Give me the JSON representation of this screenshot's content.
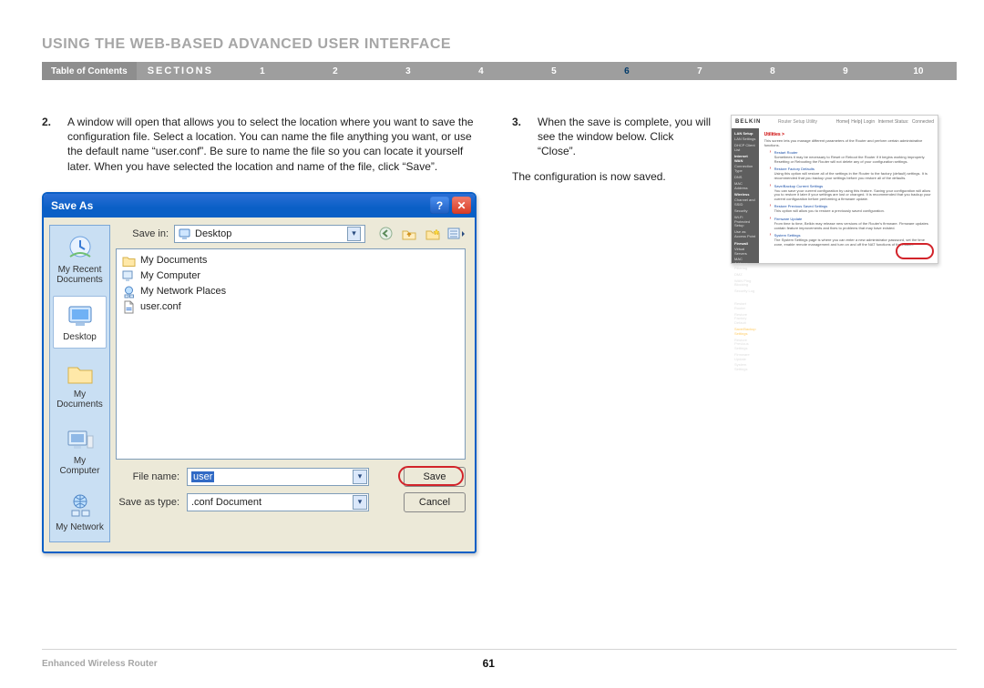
{
  "page": {
    "title": "USING THE WEB-BASED ADVANCED USER INTERFACE",
    "footer_product": "Enhanced Wireless Router",
    "page_number": "61"
  },
  "nav": {
    "toc": "Table of Contents",
    "sections": "SECTIONS",
    "items": [
      "1",
      "2",
      "3",
      "4",
      "5",
      "6",
      "7",
      "8",
      "9",
      "10"
    ],
    "active": "6"
  },
  "steps": {
    "s2": {
      "num": "2.",
      "text": "A window will open that allows you to select the location where you want to save the configuration file. Select a location. You can name the file anything you want, or use the default name “user.conf”. Be sure to name the file so you can locate it yourself later. When you have selected the location and name of the file, click “Save”."
    },
    "s3": {
      "num": "3.",
      "text": "When the save is complete, you will see the window below. Click “Close”."
    },
    "note": "The configuration is now saved."
  },
  "saveas": {
    "title": "Save As",
    "save_in_label": "Save in:",
    "save_in_value": "Desktop",
    "places": {
      "recent": "My Recent Documents",
      "desktop": "Desktop",
      "mydocs": "My Documents",
      "mycomputer": "My Computer",
      "mynetwork": "My Network"
    },
    "folder_items": [
      {
        "label": "My Documents"
      },
      {
        "label": "My Computer"
      },
      {
        "label": "My Network Places"
      },
      {
        "label": "user.conf"
      }
    ],
    "file_name_label": "File name:",
    "file_name_value": "user",
    "save_type_label": "Save as type:",
    "save_type_value": ".conf Document",
    "save_btn": "Save",
    "cancel_btn": "Cancel"
  },
  "belkin": {
    "brand": "BELKIN",
    "product": "Router Setup Utility",
    "links": {
      "home": "Home",
      "help": "Help",
      "login": "Login",
      "status": "Internet Status:",
      "logout": "Connected"
    },
    "sidebar": {
      "g1": "LAN Setup",
      "i1a": "LAN Settings",
      "i1b": "DHCP Client List",
      "g2": "Internet WAN",
      "i2a": "Connection Type",
      "i2b": "DNS",
      "i2c": "MAC Address",
      "g3": "Wireless",
      "i3a": "Channel and SSID",
      "i3b": "Security",
      "i3c": "Wi-Fi Protected Setup",
      "i3d": "Use as Access Point",
      "g4": "Firewall",
      "i4a": "Virtual Servers",
      "i4b": "MAC Address Filtering",
      "i4c": "DMZ",
      "i4d": "WAN Ping Blocking",
      "i4e": "Security Log",
      "g5": "Utilities",
      "i5a": "Restart Router",
      "i5b": "Restore Factory Default",
      "i5c": "Save/Backup Settings",
      "i5d": "Restore Previous Settings",
      "i5e": "Firmware Update",
      "i5f": "System Settings"
    },
    "main": {
      "heading": "Utilities >",
      "p1": "This screen lets you manage different parameters of the Router and perform certain administrative functions.",
      "b1t": "Restart Router",
      "b1": "Sometimes it may be necessary to Reset or Reboot the Router if it begins working improperly. Resetting or Rebooting the Router will not delete any of your configuration settings.",
      "b2t": "Restore Factory Defaults",
      "b2": "Using this option will restore all of the settings in the Router to the factory (default) settings. It is recommended that you backup your settings before you restore all of the defaults.",
      "b3t": "Save/Backup Current Settings",
      "b3": "You can save your current configuration by using this feature. Saving your configuration will allow you to restore it later if your settings are lost or changed. It is recommended that you backup your current configuration before performing a firmware update.",
      "b4t": "Restore Previous Saved Settings",
      "b4": "This option will allow you to restore a previously saved configuration.",
      "b5t": "Firmware Update",
      "b5": "From time to time, Belkin may release new versions of the Router's firmware. Firmware updates contain feature improvements and fixes to problems that may have existed.",
      "b6t": "System Settings",
      "b6": "The System Settings page is where you can enter a new administrator password, set the time zone, enable remote management and turn on and off the NAT functions of the Router."
    }
  }
}
